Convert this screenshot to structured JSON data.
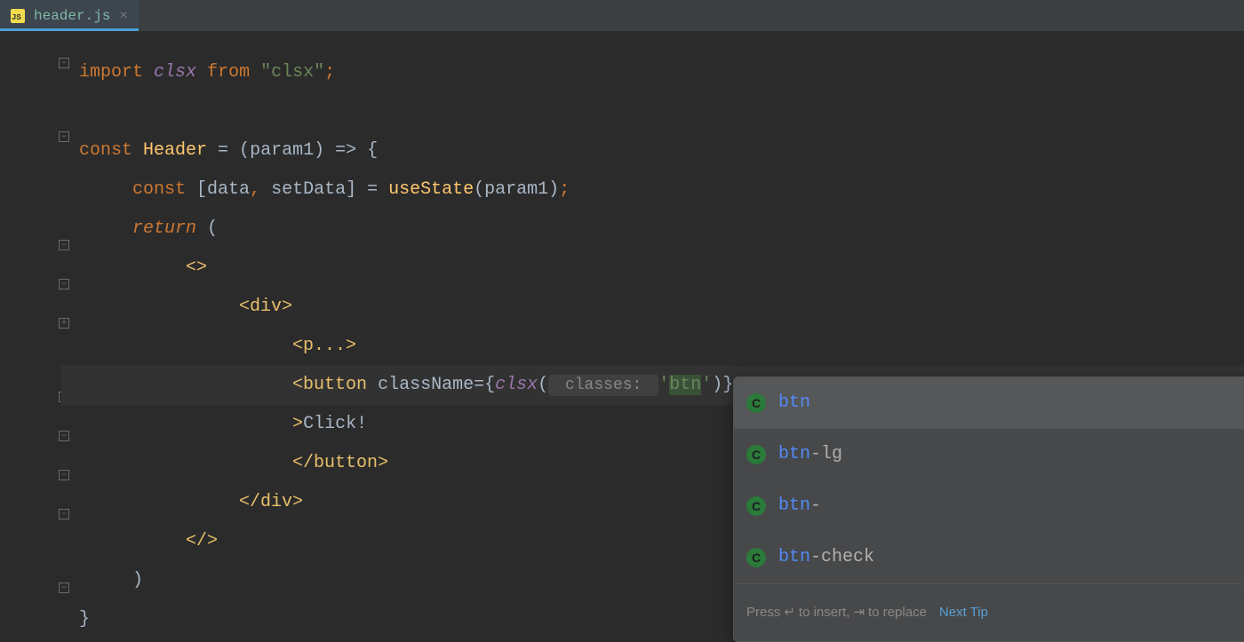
{
  "tab": {
    "filename": "header.js",
    "icon_label": "JS"
  },
  "gutter": {
    "icons": [
      "–",
      "–",
      "–",
      "–",
      "+",
      "–",
      "–",
      "–",
      "–",
      "–"
    ]
  },
  "code": {
    "line1": {
      "import": "import",
      "clsx": "clsx",
      "from": "from",
      "str": "\"clsx\"",
      "semi": ";"
    },
    "line3": {
      "const": "const",
      "Header": "Header",
      "eq": " = (",
      "param1": "param1",
      "arrow": ") => {"
    },
    "line4": {
      "const": "const",
      "open": " [",
      "data": "data",
      "comma": ",",
      "setData": "setData",
      "close": "] = ",
      "useState": "useState",
      "p1": "(",
      "param1": "param1",
      "p2": ")",
      "semi": ";"
    },
    "line5": {
      "return": "return",
      "paren": " ("
    },
    "line6": {
      "frag_open": "<>"
    },
    "line7": {
      "div_open": "<div>"
    },
    "line8": {
      "p_fold": "<p...>"
    },
    "line9": {
      "btn_open": "<button ",
      "className": "className",
      "eq": "=",
      "brace_open": "{",
      "clsx": "clsx",
      "paren_open": "(",
      "hint": " classes: ",
      "str_q1": "'",
      "str_btn": "btn",
      "str_q2": "'",
      "paren_close": ")",
      "brace_close": "}"
    },
    "line10": {
      "gt": ">",
      "text": "Click!"
    },
    "line11": {
      "btn_close": "</button>"
    },
    "line12": {
      "div_close": "</div>"
    },
    "line13": {
      "frag_close": "</>"
    },
    "line14": {
      "paren": ")"
    },
    "line15": {
      "brace": "}"
    }
  },
  "popup": {
    "items": [
      {
        "match": "btn",
        "rest": ""
      },
      {
        "match": "btn",
        "rest": "-lg"
      },
      {
        "match": "btn",
        "rest": "-"
      },
      {
        "match": "btn",
        "rest": "-check"
      }
    ],
    "footer": {
      "hint_pre": "Press ",
      "enter_icon": "↵",
      "hint_mid": " to insert, ",
      "tab_icon": "⇥",
      "hint_post": " to replace",
      "next_tip": "Next Tip"
    }
  }
}
